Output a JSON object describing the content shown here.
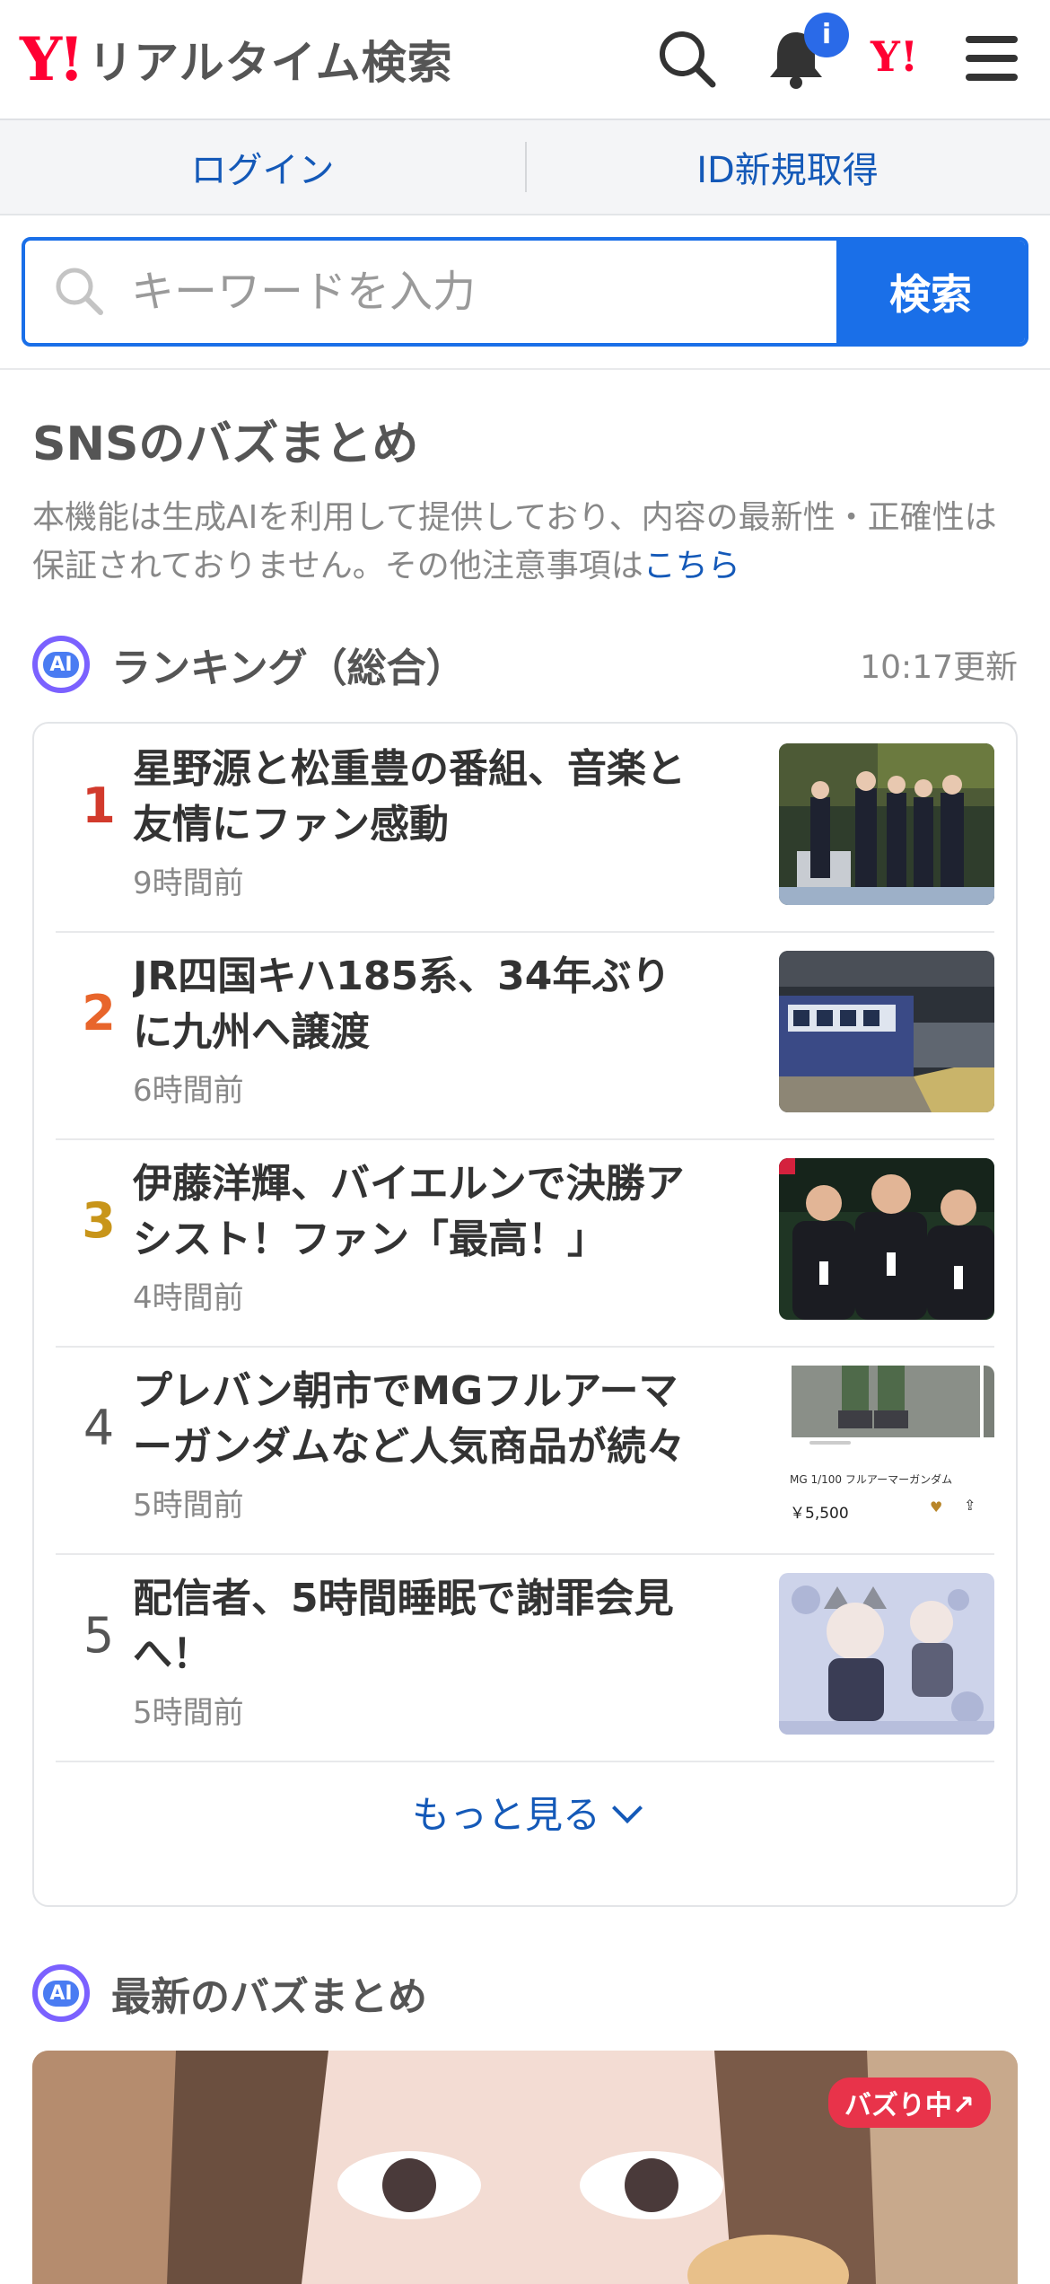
{
  "header": {
    "logo_mark": "Y!",
    "logo_text": "リアルタイム検索",
    "notification_badge": "i",
    "yahoo_mini": "Y!"
  },
  "login_bar": {
    "login": "ログイン",
    "register": "ID新規取得"
  },
  "search": {
    "placeholder": "キーワードを入力",
    "button": "検索"
  },
  "section": {
    "title": "SNSのバズまとめ",
    "notice": "本機能は生成AIを利用して提供しており、内容の最新性・正確性は保証されておりません。その他注意事項は",
    "notice_link": "こちら"
  },
  "ranking": {
    "ai_label": "AI",
    "title": "ランキング（総合）",
    "updated": "10:17更新",
    "items": [
      {
        "rank": "1",
        "title": "星野源と松重豊の番組、音楽と友情にファン感動",
        "time": "9時間前"
      },
      {
        "rank": "2",
        "title": "JR四国キハ185系、34年ぶりに九州へ譲渡",
        "time": "6時間前"
      },
      {
        "rank": "3",
        "title": "伊藤洋輝、バイエルンで決勝アシスト！ファン「最高！」",
        "time": "4時間前"
      },
      {
        "rank": "4",
        "title": "プレバン朝市でMGフルアーマーガンダムなど人気商品が続々カ...",
        "time": "5時間前"
      },
      {
        "rank": "5",
        "title": "配信者、5時間睡眠で謝罪会見へ！",
        "time": "5時間前"
      }
    ],
    "thumb4_caption": "MG 1/100 フルアーマーガンダム",
    "thumb4_price": "￥5,500",
    "more": "もっと見る"
  },
  "latest": {
    "ai_label": "AI",
    "title": "最新のバズまとめ",
    "badge": "バズり中↗"
  },
  "colors": {
    "accent": "#1a6fe8",
    "brand": "#ff0033",
    "rank1": "#d23a2c",
    "rank2": "#e8652b",
    "rank3": "#c8951a",
    "rank_other": "#555555"
  }
}
